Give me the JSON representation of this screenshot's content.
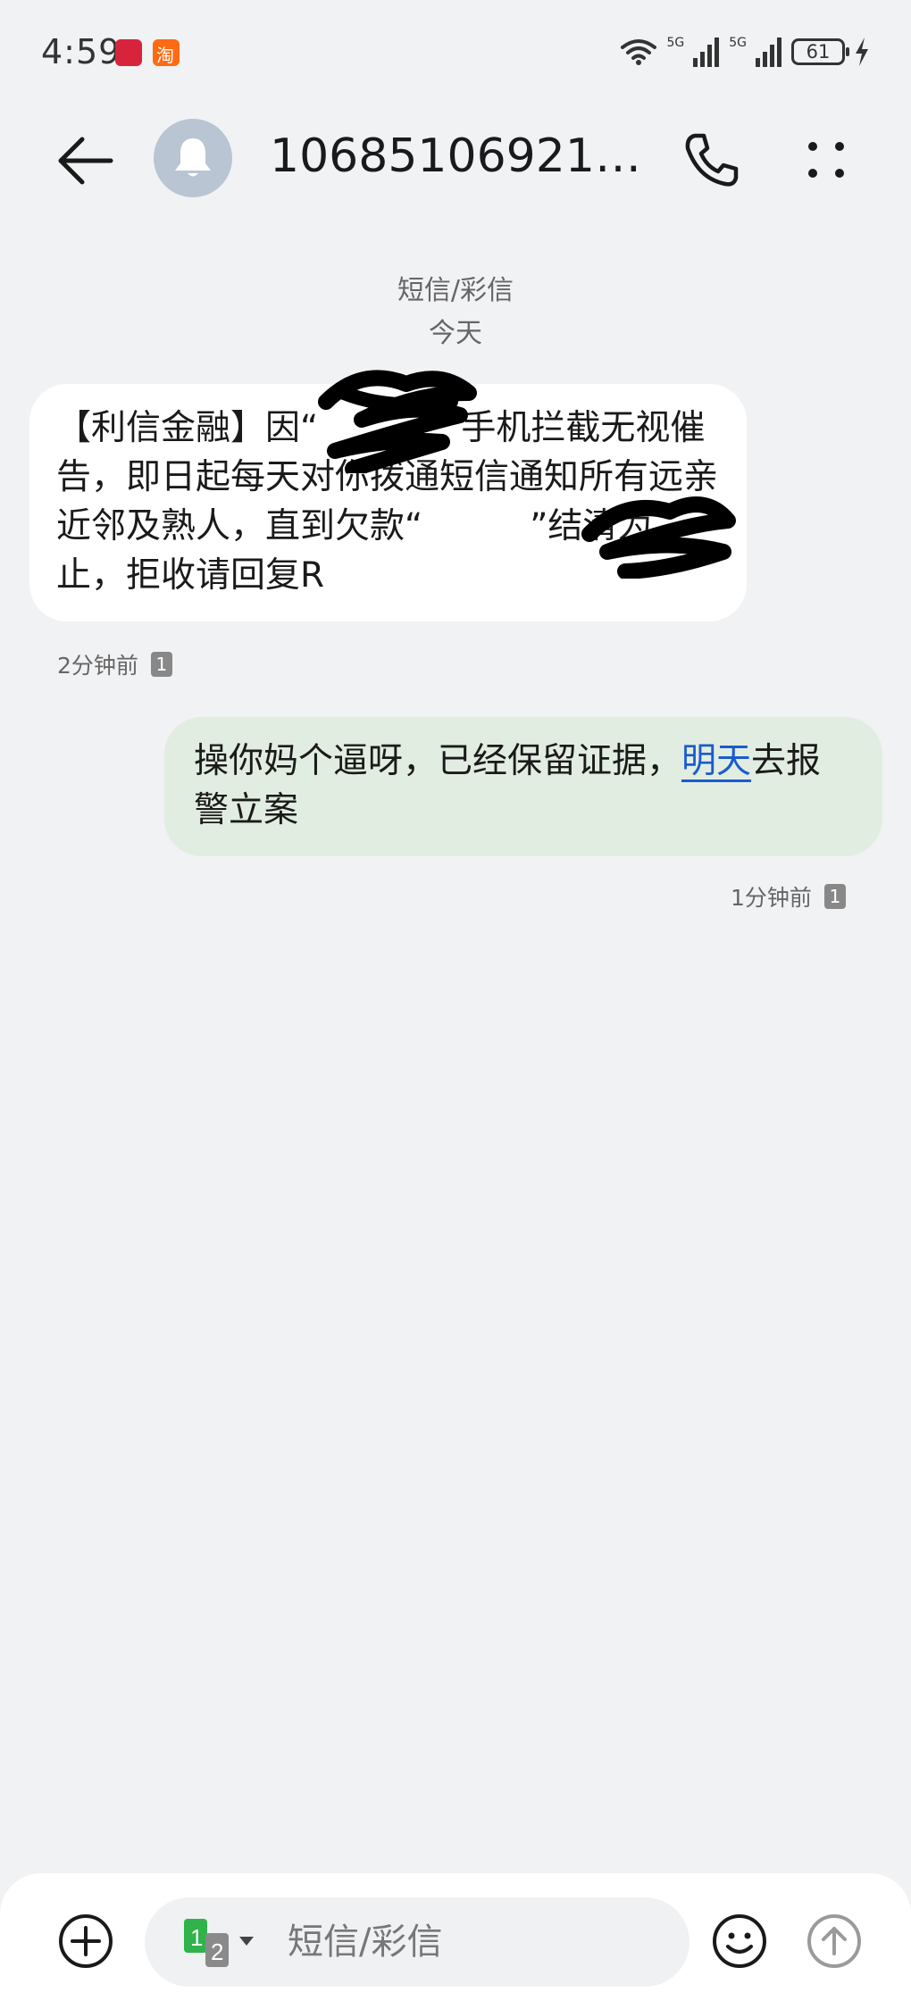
{
  "status_bar": {
    "time": "4:59",
    "app_badge_2": "淘",
    "signal_1_label": "5G",
    "signal_2_label": "5G",
    "battery_level": "61"
  },
  "header": {
    "contact_name": "106851069212..."
  },
  "conversation": {
    "channel_label": "短信/彩信",
    "date_label": "今天",
    "messages": [
      {
        "direction": "incoming",
        "text_parts": [
          "【利信金融】因“",
          "”手机拦截无视催告，即日起每天对你拨通短信通知所有远亲近邻及熟人，直到欠款“",
          "”结清为止，拒收请回复R"
        ],
        "time": "2分钟前",
        "sim": "1"
      },
      {
        "direction": "outgoing",
        "text_before": "操你妈个逼呀，已经保留证据，",
        "link_text": "明天",
        "text_after": "去报警立案",
        "time": "1分钟前",
        "sim": "1"
      }
    ]
  },
  "composer": {
    "sim_primary": "1",
    "sim_secondary": "2",
    "placeholder": "短信/彩信"
  },
  "colors": {
    "background": "#f1f2f4",
    "incoming_bubble": "#ffffff",
    "outgoing_bubble": "#e1ede0",
    "link": "#1a5ccf",
    "sim_active": "#2fb34a"
  },
  "icons": [
    "back-arrow-icon",
    "bell-icon",
    "phone-icon",
    "more-vertical-icon",
    "add-circle-icon",
    "emoji-icon",
    "send-arrow-icon",
    "wifi-icon",
    "signal-icon",
    "charging-bolt-icon"
  ]
}
